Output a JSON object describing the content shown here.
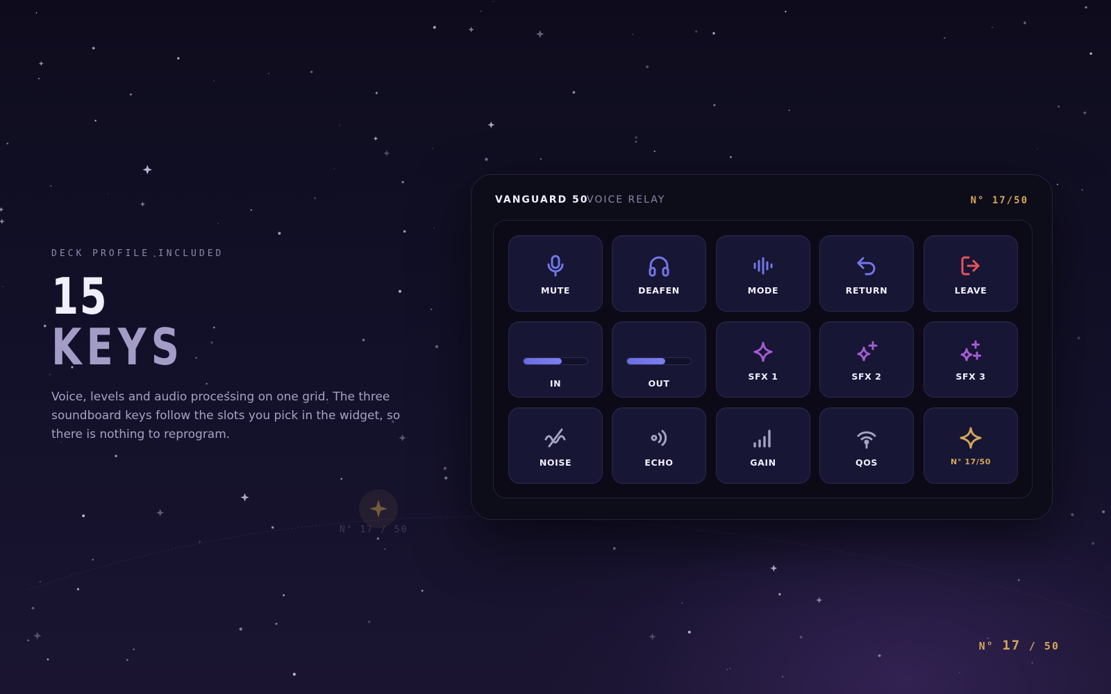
{
  "hero": {
    "eyebrow": "DECK PROFILE INCLUDED",
    "number": "15",
    "word": "KEYS",
    "description": "Voice, levels and audio processing on one grid. The three soundboard keys follow the slots you pick in the widget, so there is nothing to reprogram."
  },
  "deck": {
    "brand": "VANGUARD 50",
    "model": "VOICE RELAY",
    "serial": "N° 17/50",
    "keys": [
      {
        "label": "MUTE",
        "icon": "microphone-icon",
        "color": "#7377e8"
      },
      {
        "label": "DEAFEN",
        "icon": "headphones-icon",
        "color": "#7377e8"
      },
      {
        "label": "MODE",
        "icon": "waveform-icon",
        "color": "#7377e8"
      },
      {
        "label": "RETURN",
        "icon": "return-arrow-icon",
        "color": "#7377e8"
      },
      {
        "label": "LEAVE",
        "icon": "leave-icon",
        "color": "#e8535d"
      },
      {
        "label": "IN",
        "level": 0.6,
        "color": "#6a6ee0"
      },
      {
        "label": "OUT",
        "level": 0.6,
        "color": "#6a6ee0"
      },
      {
        "label": "SFX 1",
        "icon": "sparkle-icon",
        "color": "#a35bd6"
      },
      {
        "label": "SFX 2",
        "icon": "sparkle-plus-icon",
        "color": "#a35bd6"
      },
      {
        "label": "SFX 3",
        "icon": "sparkles-icon",
        "color": "#a35bd6"
      },
      {
        "label": "NOISE",
        "icon": "noise-suppression-icon",
        "color": "#a6a2c4"
      },
      {
        "label": "ECHO",
        "icon": "echo-icon",
        "color": "#a6a2c4"
      },
      {
        "label": "GAIN",
        "icon": "signal-bars-icon",
        "color": "#a6a2c4"
      },
      {
        "label": "QOS",
        "icon": "broadcast-icon",
        "color": "#a6a2c4"
      },
      {
        "label": "N° 17/50",
        "icon": "gold-star-icon",
        "color": "#d6a55a"
      }
    ]
  },
  "corner": {
    "prefix": "N°",
    "number": "17",
    "suffix": "/ 50"
  },
  "ghost_serial": "N° 17 / 50",
  "colors": {
    "accent": "#d6a55a",
    "primary": "#7377e8",
    "danger": "#e8535d",
    "sfx": "#a35bd6"
  }
}
